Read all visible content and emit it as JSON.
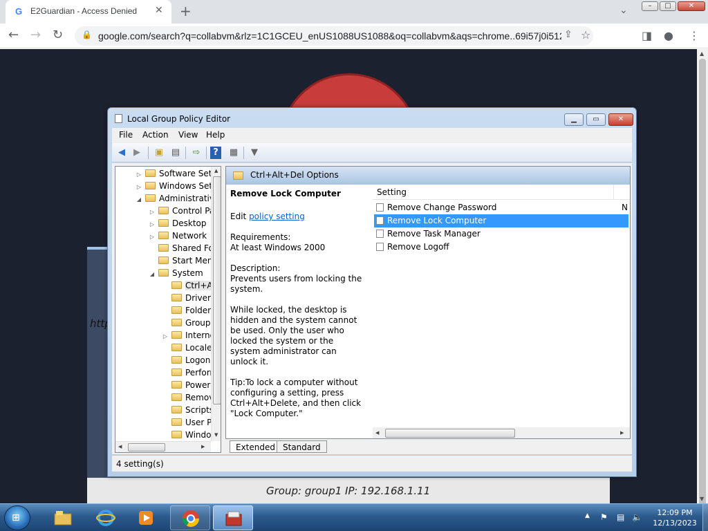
{
  "browser": {
    "tab_title": "E2Guardian - Access Denied",
    "tab_favicon": "google-g-icon",
    "url": "google.com/search?q=collabvm&rlz=1C1GCEU_enUS1088US1088&oq=collabvm&aqs=chrome..69i57j0i512l5j0i...",
    "window_min": "–",
    "window_max": "□",
    "window_close": "✕"
  },
  "background": {
    "http_fragment": "http",
    "group_line": "Group: group1   IP: 192.168.1.11"
  },
  "gpe": {
    "title": "Local Group Policy Editor",
    "menu": [
      "File",
      "Action",
      "View",
      "Help"
    ],
    "tree": [
      {
        "label": "Software Setti",
        "arrow": "▷"
      },
      {
        "label": "Windows Sett",
        "arrow": "▷"
      },
      {
        "label": "Administrative",
        "arrow": "◢"
      },
      {
        "label": "Control Pa",
        "arrow": "▷"
      },
      {
        "label": "Desktop",
        "arrow": "▷"
      },
      {
        "label": "Network",
        "arrow": "▷"
      },
      {
        "label": "Shared Fol",
        "arrow": ""
      },
      {
        "label": "Start Menu",
        "arrow": ""
      },
      {
        "label": "System",
        "arrow": "◢"
      },
      {
        "label": "Ctrl+A",
        "arrow": ""
      },
      {
        "label": "Driver I",
        "arrow": ""
      },
      {
        "label": "Folder",
        "arrow": ""
      },
      {
        "label": "Group",
        "arrow": ""
      },
      {
        "label": "Interne",
        "arrow": "▷"
      },
      {
        "label": "Locale",
        "arrow": ""
      },
      {
        "label": "Logon",
        "arrow": ""
      },
      {
        "label": "Perforn",
        "arrow": ""
      },
      {
        "label": "Power",
        "arrow": ""
      },
      {
        "label": "Remov",
        "arrow": ""
      },
      {
        "label": "Scripts",
        "arrow": ""
      },
      {
        "label": "User Pr",
        "arrow": ""
      },
      {
        "label": "Windo",
        "arrow": ""
      }
    ],
    "pane_title": "Ctrl+Alt+Del Options",
    "desc": {
      "heading": "Remove Lock Computer",
      "edit_prefix": "Edit ",
      "edit_link": "policy setting",
      "requirements_label": "Requirements:",
      "requirements": "At least Windows 2000",
      "description_label": "Description:",
      "description": "Prevents users from locking the system.",
      "paragraph2": "While locked, the desktop is hidden and the system cannot be used. Only the user who locked the system or the system administrator can unlock it.",
      "tip": "Tip:To lock a computer without configuring a setting, press Ctrl+Alt+Delete, and then click \"Lock Computer.\""
    },
    "column_setting": "Setting",
    "rows": [
      {
        "label": "Remove Change Password",
        "state": "N"
      },
      {
        "label": "Remove Lock Computer",
        "state": ""
      },
      {
        "label": "Remove Task Manager",
        "state": ""
      },
      {
        "label": "Remove Logoff",
        "state": ""
      }
    ],
    "selected_row": 1,
    "tab_extended": "Extended",
    "tab_standard": "Standard",
    "status": "4 setting(s)"
  },
  "taskbar": {
    "time": "12:09 PM",
    "date": "12/13/2023",
    "items": [
      "explorer-icon",
      "ie-icon",
      "media-player-icon",
      "chrome-icon",
      "gpe-icon"
    ]
  },
  "colors": {
    "selection": "#3399ff",
    "link": "#0066cc",
    "page_bg": "#1c2130"
  }
}
